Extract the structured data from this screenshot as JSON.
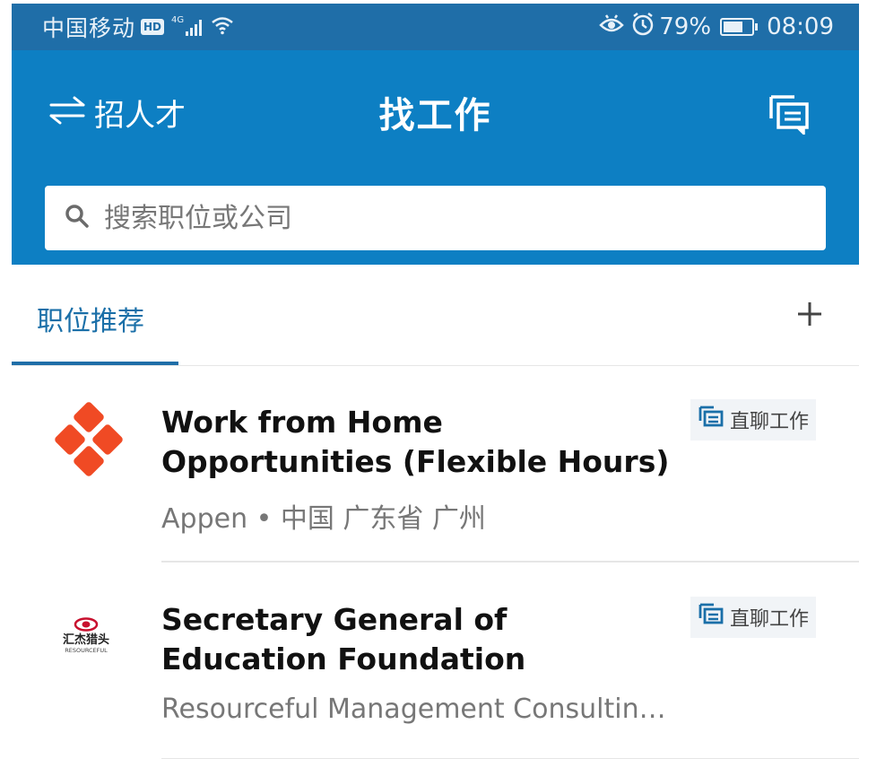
{
  "status_bar": {
    "carrier": "中国移动",
    "hd": "HD",
    "network": "4G",
    "battery_text": "79%",
    "battery_level": 0.79,
    "time": "08:09"
  },
  "header": {
    "switch_label": "招人才",
    "title": "找工作",
    "switch_icon": "swap-arrows-icon",
    "chat_icon": "chat-list-icon"
  },
  "search": {
    "placeholder": "搜索职位或公司"
  },
  "tabs": {
    "active": "职位推荐"
  },
  "jobs": [
    {
      "title": "Work from Home Opportunities (Flexible Hours)",
      "meta": "Appen • 中国 广东省 广州",
      "badge": "直聊工作",
      "logo_icon": "appen-logo"
    },
    {
      "title": "Secretary General of Education Foundation",
      "meta": "Resourceful Management Consultin…",
      "badge": "直聊工作",
      "logo_icon": "resourceful-logo",
      "logo_text": "汇杰猎头",
      "logo_subtext": "RESOURCEFUL"
    }
  ],
  "colors": {
    "status_bar": "#1f6ea8",
    "header": "#0d7fc3",
    "accent": "#1a6fa8",
    "appen_red": "#f04a24",
    "resourceful_red": "#c8102e"
  }
}
